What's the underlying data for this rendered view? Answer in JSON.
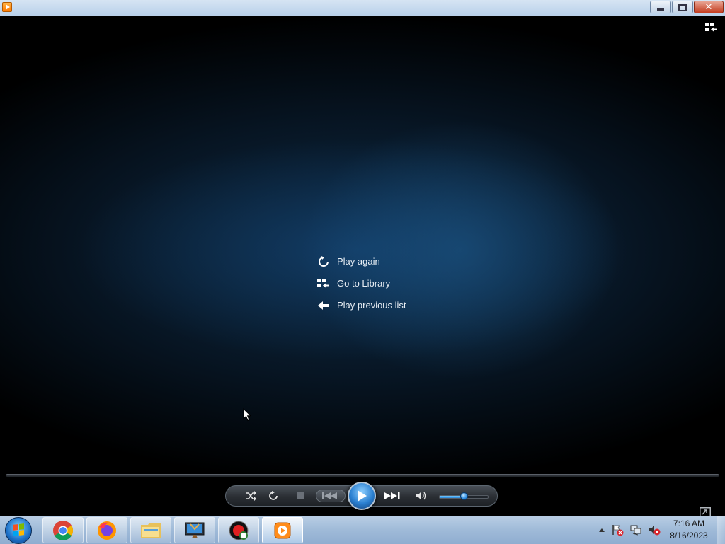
{
  "window": {
    "title": "",
    "controls": {
      "minimize": "minimize",
      "restore": "restore",
      "close": "close"
    }
  },
  "player": {
    "switch_to_library_icon": "switch-to-library-icon",
    "menu": [
      {
        "label": "Play again",
        "icon": "replay-icon"
      },
      {
        "label": "Go to Library",
        "icon": "library-icon"
      },
      {
        "label": "Play previous list",
        "icon": "back-arrow-icon"
      }
    ],
    "controls": {
      "shuffle": "shuffle-icon",
      "repeat": "repeat-icon",
      "stop": "stop-icon",
      "previous": "previous-icon",
      "play": "play-icon",
      "next": "next-icon",
      "mute": "speaker-icon",
      "volume_level": 0.5
    },
    "seek_progress": 0,
    "accent_color": "#2a7fd0"
  },
  "taskbar": {
    "apps": [
      {
        "name": "Google Chrome",
        "icon": "chrome-icon"
      },
      {
        "name": "Firefox",
        "icon": "firefox-icon"
      },
      {
        "name": "File Explorer",
        "icon": "folder-icon"
      },
      {
        "name": "TV app",
        "icon": "tv-icon"
      },
      {
        "name": "Record app",
        "icon": "record-icon"
      },
      {
        "name": "Windows Media Player",
        "icon": "media-player-icon"
      }
    ],
    "active_app": "Windows Media Player",
    "tray": [
      "show-hidden-icons",
      "action-center-flag-icon",
      "network-icon",
      "volume-muted-icon"
    ],
    "clock": {
      "time": "7:16 AM",
      "date": "8/16/2023"
    }
  }
}
